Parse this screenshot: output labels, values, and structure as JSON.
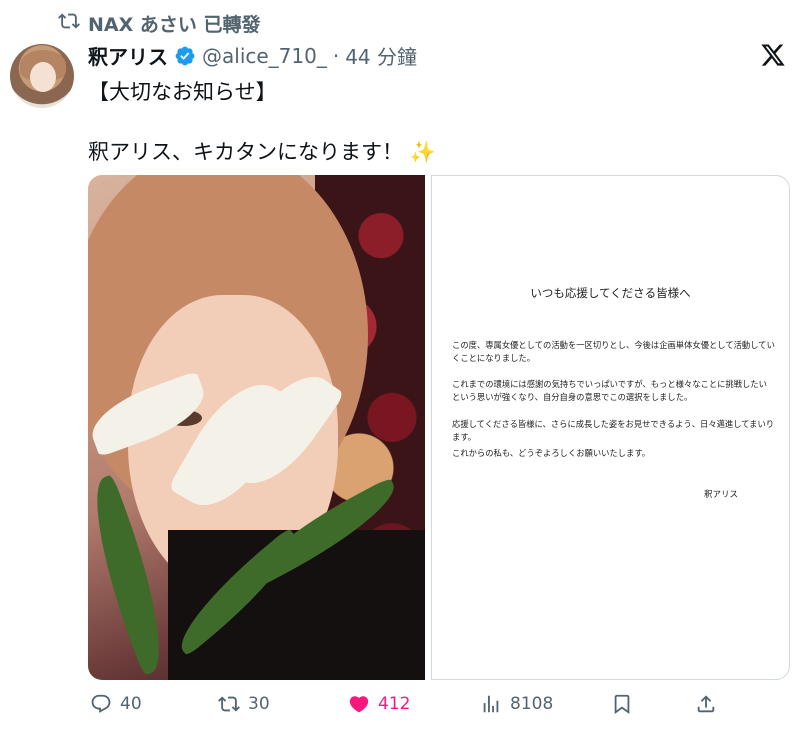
{
  "retweet": {
    "text": "NAX あさい 已轉發"
  },
  "author": {
    "display_name": "釈アリス",
    "handle": "@alice_710_",
    "dot": "·",
    "time": "44 分鐘"
  },
  "tweet": {
    "title": "【大切なお知らせ】",
    "body": "釈アリス、キカタンになります！",
    "emoji": "✨"
  },
  "letter": {
    "heading": "いつも応援してくださる皆様へ",
    "paragraphs": [
      "この度、専属女優としての活動を一区切りとし、今後は企画単体女優として活動していくことになりました。",
      "これまでの環境には感謝の気持ちでいっぱいですが、もっと様々なことに挑戦したいという思いが強くなり、自分自身の意思でこの選択をしました。",
      "応援してくださる皆様に、さらに成長した姿をお見せできるよう、日々邁進してまいります。",
      "これからの私も、どうぞよろしくお願いいたします。"
    ],
    "signature": "釈アリス"
  },
  "actions": {
    "replies": "40",
    "reposts": "30",
    "likes": "412",
    "views": "8108"
  },
  "colors": {
    "text": "#0f1419",
    "secondary": "#536471",
    "like": "#f91880",
    "verified": "#1d9bf0"
  }
}
